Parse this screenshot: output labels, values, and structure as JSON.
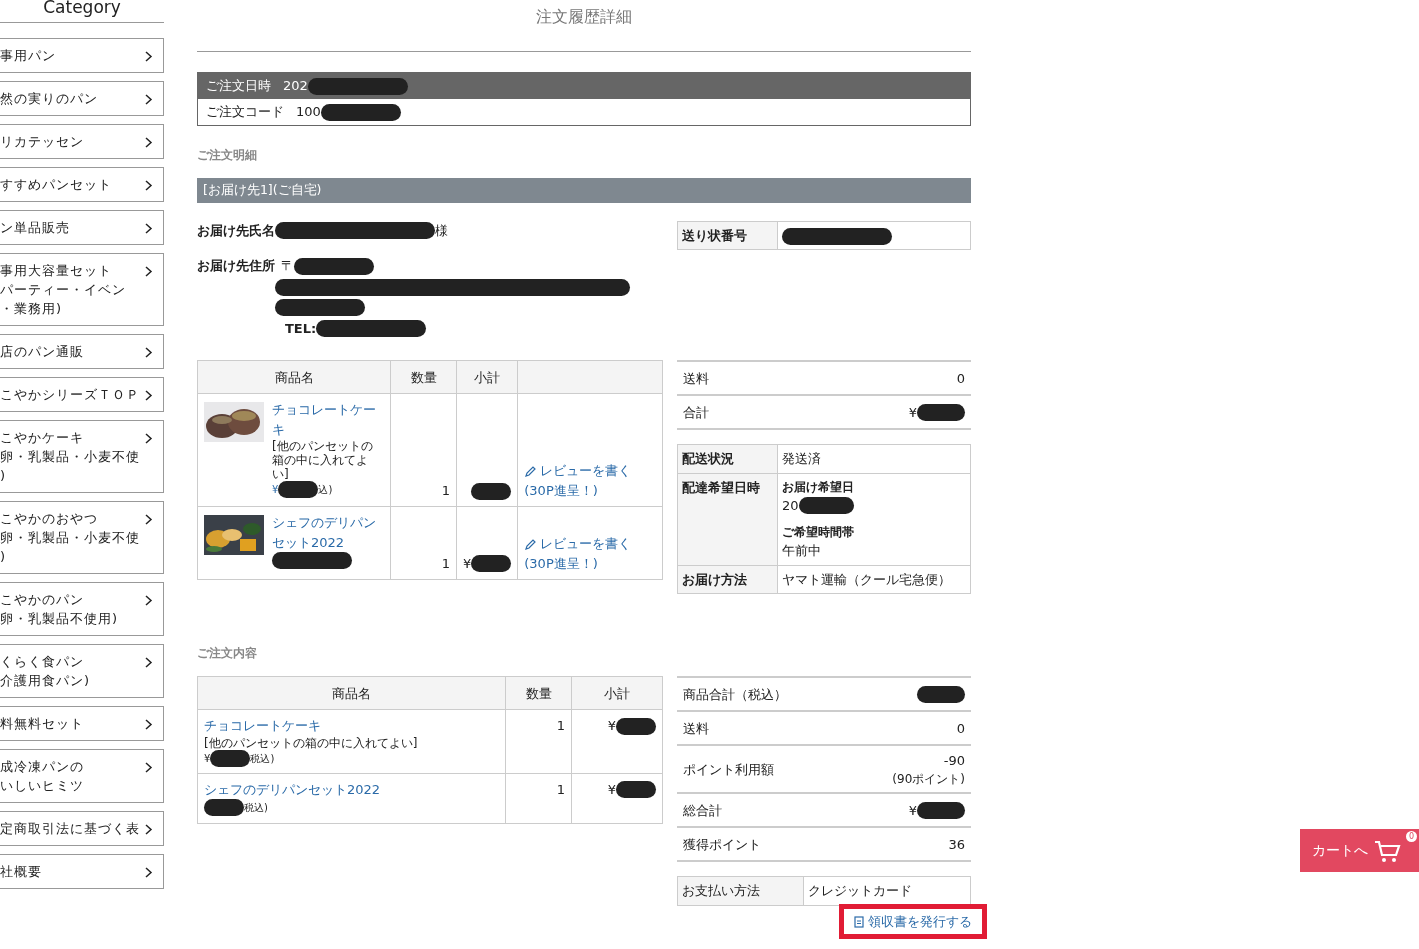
{
  "sidebar": {
    "title": "Category",
    "items": [
      {
        "lines": [
          "事用パン"
        ]
      },
      {
        "lines": [
          "然の実りのパン"
        ]
      },
      {
        "lines": [
          "リカテッセン"
        ]
      },
      {
        "lines": [
          "すすめパンセット"
        ]
      },
      {
        "lines": [
          "ン単品販売"
        ]
      },
      {
        "lines": [
          "事用大容量セット",
          "パーティー・イベン",
          "・業務用)"
        ]
      },
      {
        "lines": [
          "店のパン通販"
        ]
      },
      {
        "lines": [
          "こやかシリーズＴＯＰ"
        ]
      },
      {
        "lines": [
          "こやかケーキ",
          "卵・乳製品・小麦不使",
          ")"
        ]
      },
      {
        "lines": [
          "こやかのおやつ",
          "卵・乳製品・小麦不使",
          ")"
        ]
      },
      {
        "lines": [
          "こやかのパン",
          "卵・乳製品不使用)"
        ]
      },
      {
        "lines": [
          "くらく食パン",
          "介護用食パン)"
        ]
      },
      {
        "lines": [
          "料無料セット"
        ]
      },
      {
        "lines": [
          "成冷凍パンの",
          "いしいヒミツ"
        ]
      },
      {
        "lines": [
          "定商取引法に基づく表"
        ]
      },
      {
        "lines": [
          "社概要"
        ]
      }
    ]
  },
  "page_title": "注文履歴詳細",
  "order_info": [
    {
      "label": "ご注文日時",
      "value": "202",
      "redacted": true
    },
    {
      "label": "ご注文コード",
      "value": "100",
      "redacted": true
    }
  ],
  "detail_heading": "ご注文明細",
  "destination_bar": "[お届け先1](ご自宅)",
  "recipient": {
    "name_label": "お届け先氏名",
    "name_suffix": "様",
    "address_label": "お届け先住所",
    "address_lines": [
      {
        "text": "〒",
        "redacted": true
      },
      {
        "redacted": true
      },
      {
        "redacted": true
      },
      {
        "text": "TEL:",
        "redacted": true
      }
    ]
  },
  "tracking": {
    "label": "送り状番号",
    "redacted": true
  },
  "items_table": {
    "columns": [
      "商品名",
      "数量",
      "小計"
    ],
    "rows": [
      {
        "name": "チョコレートケーキ",
        "note": "[他のパンセットの箱の中に入れてよい]",
        "price_prefix": "¥",
        "price_suffix": "込)",
        "qty": "1",
        "review": "レビューを書く",
        "review_bonus": "(30P進呈！)"
      },
      {
        "name": "シェフのデリパンセット2022",
        "qty": "1",
        "subtotal_prefix": "¥",
        "review": "レビューを書く",
        "review_bonus": "(30P進呈！)"
      }
    ]
  },
  "summary": [
    {
      "label": "送料",
      "value": "0"
    },
    {
      "label": "合計",
      "value": "¥",
      "redacted": true
    }
  ],
  "delivery": [
    {
      "label": "配送状況",
      "kind": "text",
      "value": "発送済"
    },
    {
      "label": "配達希望日時",
      "kind": "schedule",
      "parts": [
        {
          "caption": "お届け希望日",
          "value": "20",
          "redacted": true
        },
        {
          "caption": "ご希望時間帯",
          "value": "午前中"
        }
      ]
    },
    {
      "label": "お届け方法",
      "kind": "text",
      "value": "ヤマト運輸（クール宅急便）"
    }
  ],
  "contents_heading": "ご注文内容",
  "contents_table": {
    "columns": [
      "商品名",
      "数量",
      "小計"
    ],
    "rows": [
      {
        "name": "チョコレートケーキ",
        "note": "[他のパンセットの箱の中に入れてよい]",
        "price_prefix": "¥",
        "price_suffix": "税込)",
        "qty": "1",
        "subtotal_prefix": "¥"
      },
      {
        "name": "シェフのデリパンセット2022",
        "price_suffix": "税込)",
        "qty": "1",
        "subtotal_prefix": "¥"
      }
    ]
  },
  "totals": [
    {
      "label": "商品合計（税込）",
      "redacted": true
    },
    {
      "label": "送料",
      "value": "0"
    },
    {
      "label": "ポイント利用額",
      "value": "-90",
      "sub": "(90ポイント)"
    },
    {
      "label": "総合計",
      "value": "¥",
      "redacted": true
    },
    {
      "label": "獲得ポイント",
      "value": "36"
    }
  ],
  "payment": {
    "label": "お支払い方法",
    "value": "クレジットカード"
  },
  "receipt_button": {
    "label": "領収書を発行する",
    "highlighted": true
  },
  "cart_button": {
    "label": "カートへ",
    "count": "0"
  }
}
